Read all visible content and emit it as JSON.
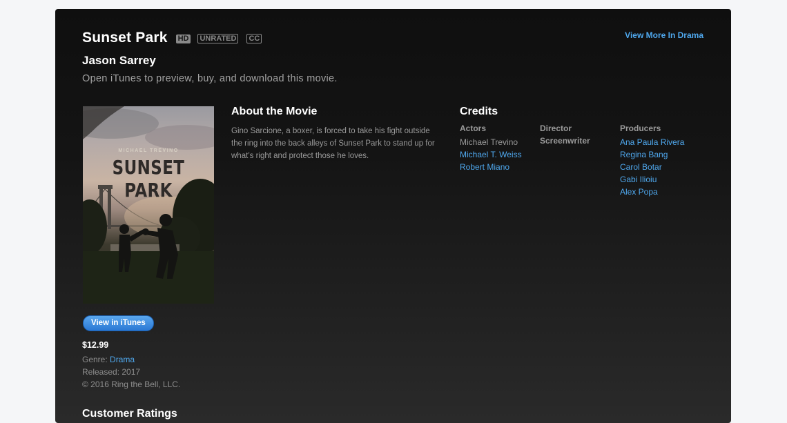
{
  "movie": {
    "title": "Sunset Park",
    "badges": [
      "HD",
      "UNRATED",
      "CC"
    ],
    "author": "Jason Sarrey",
    "tagline": "Open iTunes to preview, buy, and download this movie."
  },
  "links": {
    "view_more": "View More In Drama"
  },
  "poster": {
    "director_line": "MICHAEL TREVINO",
    "title": "SUNSET PARK"
  },
  "purchase": {
    "button": "View in iTunes",
    "price": "$12.99"
  },
  "meta": {
    "genre_label": "Genre:",
    "genre_value": "Drama",
    "released": "Released: 2017",
    "copyright": "© 2016 Ring the Bell, LLC."
  },
  "about": {
    "heading": "About the Movie",
    "text": "Gino Sarcione, a boxer, is forced to take his fight outside the ring into the back alleys of Sunset Park to stand up for what’s right and protect those he loves."
  },
  "credits": {
    "heading": "Credits",
    "actors_label": "Actors",
    "actors": [
      "Michael Trevino",
      "Michael T. Weiss",
      "Robert Miano"
    ],
    "director_label": "Director",
    "screenwriter_label": "Screenwriter",
    "producers_label": "Producers",
    "producers": [
      "Ana Paula Rivera",
      "Regina Bang",
      "Carol Botar",
      "Gabi Ilioiu",
      "Alex Popa"
    ]
  },
  "ratings": {
    "heading": "Customer Ratings"
  },
  "colors": {
    "link": "#4fa8ee",
    "button": "#2a78d4"
  }
}
